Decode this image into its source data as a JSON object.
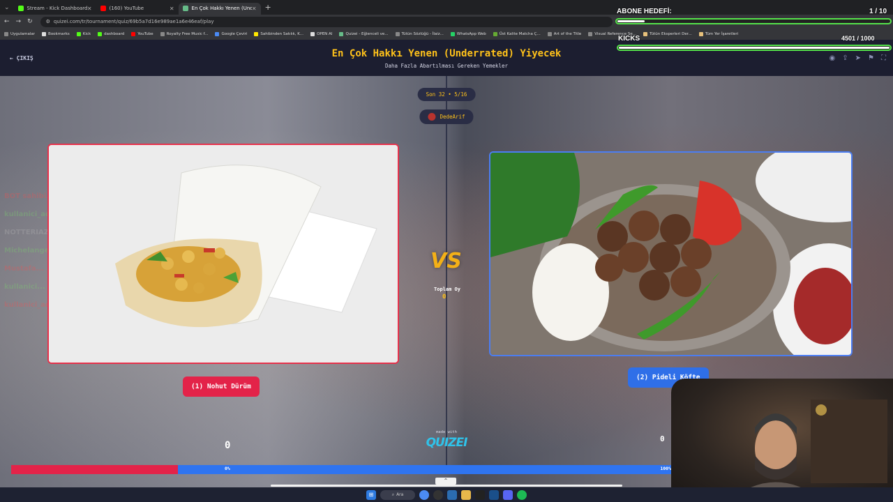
{
  "browser": {
    "tabs": [
      {
        "title": "Stream - Kick Dashboard",
        "color": "#53fc18"
      },
      {
        "title": "(160) YouTube",
        "color": "#ff0000"
      },
      {
        "title": "En Çok Hakkı Yenen (Underrat",
        "color": "#6b8"
      }
    ],
    "new_tab": "+",
    "url": "quizei.com/tr/tournament/quiz/69b5a7d16e989ae1a6e46eaf/play",
    "bookmarks": [
      "Uygulamalar",
      "Bookmarks",
      "Kick",
      "dashboard",
      "YouTube",
      "Royalty Free Music f...",
      "Google Çeviri",
      "Sahibinden Satılık, K...",
      "OPEN AI",
      "Quizei - Eğlenceli ve...",
      "Tütün Sözlüğü - İlaiz...",
      "WhatsApp Web",
      "Üst Kalite Matcha Ç...",
      "Art of the Title",
      "Visual Reference Se...",
      "Tütün Eksperleri Der...",
      "Tüm Yer İşaretleri"
    ]
  },
  "header": {
    "exit_label": "← ÇIKIŞ",
    "title": "En Çok Hakkı Yenen (Underrated) Yiyecek",
    "subtitle": "Daha Fazla Abartılması Gereken Yemekler"
  },
  "game": {
    "round": "Son 32 • 5/16",
    "user": "DedeArif",
    "vs": "VS",
    "total_votes_label": "Toplam Oy",
    "total_votes_value": "0",
    "left": {
      "label": "(1) Nohut Dürüm",
      "votes": "0",
      "image": "nohut-durum-wrap"
    },
    "right": {
      "label": "(2) Pideli Köfte",
      "votes": "0",
      "image": "pideli-kofte-plate"
    },
    "left_percent": "0%",
    "right_percent": "100%",
    "progress_left_fraction": 0.253,
    "made_with": "made with",
    "logo": "QUIZEI"
  },
  "chat_ghost": [
    "BOT sahibi...",
    "kullanici_adi...",
    "NOTTERIAZEZANAR",
    "Michelangelo_dio_2",
    "Mustafa...",
    "kullanici...",
    "kullanici_adi..."
  ],
  "overlay": {
    "sub_goal_label": "ABONE HEDEFİ:",
    "sub_goal_value": "1 / 10",
    "sub_fraction": 0.1,
    "kicks_label": "KICKS",
    "kicks_value": "4501 / 1000",
    "kicks_fraction": 1.0
  },
  "taskbar": {
    "search": "Ara"
  }
}
